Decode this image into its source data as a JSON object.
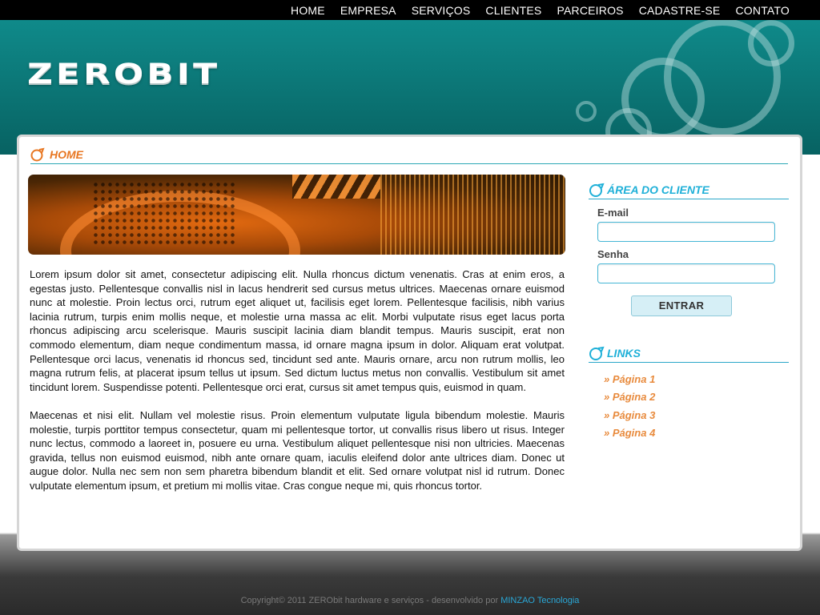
{
  "nav": {
    "items": [
      "HOME",
      "EMPRESA",
      "SERVIÇOS",
      "CLIENTES",
      "PARCEIROS",
      "CADASTRE-SE",
      "CONTATO"
    ]
  },
  "header": {
    "logo_text": "ZEROBIT"
  },
  "main": {
    "section_title": "HOME",
    "paragraphs": [
      "Lorem ipsum dolor sit amet, consectetur adipiscing elit. Nulla rhoncus dictum venenatis. Cras at enim eros, a egestas justo. Pellentesque convallis nisl in lacus hendrerit sed cursus metus ultrices. Maecenas ornare euismod nunc at molestie. Proin lectus orci, rutrum eget aliquet ut, facilisis eget lorem. Pellentesque facilisis, nibh varius lacinia rutrum, turpis enim mollis neque, et molestie urna massa ac elit. Morbi vulputate risus eget lacus porta rhoncus adipiscing arcu scelerisque. Mauris suscipit lacinia diam blandit tempus. Mauris suscipit, erat non commodo elementum, diam neque condimentum massa, id ornare magna ipsum in dolor. Aliquam erat volutpat. Pellentesque orci lacus, venenatis id rhoncus sed, tincidunt sed ante. Mauris ornare, arcu non rutrum mollis, leo magna rutrum felis, at placerat ipsum tellus ut ipsum. Sed dictum luctus metus non convallis. Vestibulum sit amet tincidunt lorem. Suspendisse potenti. Pellentesque orci erat, cursus sit amet tempus quis, euismod in quam.",
      "Maecenas et nisi elit. Nullam vel molestie risus. Proin elementum vulputate ligula bibendum molestie. Mauris molestie, turpis porttitor tempus consectetur, quam mi pellentesque tortor, ut convallis risus libero ut risus. Integer nunc lectus, commodo a laoreet in, posuere eu urna. Vestibulum aliquet pellentesque nisi non ultricies. Maecenas gravida, tellus non euismod euismod, nibh ante ornare quam, iaculis eleifend dolor ante ultrices diam. Donec ut augue dolor. Nulla nec sem non sem pharetra bibendum blandit et elit. Sed ornare volutpat nisl id rutrum. Donec vulputate elementum ipsum, et pretium mi mollis vitae. Cras congue neque mi, quis rhoncus tortor."
    ]
  },
  "sidebar": {
    "client_title": "ÁREA DO CLIENTE",
    "email_label": "E-mail",
    "email_value": "",
    "password_label": "Senha",
    "password_value": "",
    "submit_label": "ENTRAR",
    "links_title": "LINKS",
    "links": [
      "» Página 1",
      "» Página 2",
      "» Página 3",
      "» Página 4"
    ]
  },
  "footer": {
    "copyright": "Copyright© 2011 ZERObit hardware e serviços - desenvolvido por",
    "brand": "MINZAO Tecnologia"
  },
  "colors": {
    "header_teal": "#0c7878",
    "accent_orange": "#e87722",
    "accent_cyan": "#1fb0d8"
  }
}
